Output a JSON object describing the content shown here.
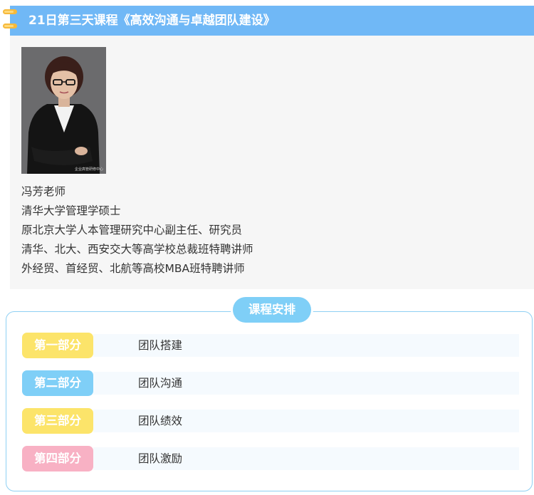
{
  "header": {
    "title": "21日第三天课程《高效沟通与卓越团队建设》",
    "background_color": "#70b8f6",
    "binder_color": "#f6b93b"
  },
  "teacher": {
    "photo_watermark": "企业高管研修中心",
    "lines": [
      "冯芳老师",
      "清华大学管理学硕士",
      "原北京大学人本管理研究中心副主任、研究员",
      "清华、北大、西安交大等高学校总裁班特聘讲师",
      "外经贸、首经贸、北航等高校MBA班特聘讲师"
    ]
  },
  "schedule": {
    "badge": "课程安排",
    "badge_color": "#7fcff7",
    "border_color": "#8fd0f3",
    "parts": [
      {
        "label": "第一部分",
        "topic": "团队搭建",
        "color": "#fce46a"
      },
      {
        "label": "第二部分",
        "topic": "团队沟通",
        "color": "#7fcff7"
      },
      {
        "label": "第三部分",
        "topic": "团队绩效",
        "color": "#fce46a"
      },
      {
        "label": "第四部分",
        "topic": "团队激励",
        "color": "#f8b1c4"
      }
    ]
  }
}
